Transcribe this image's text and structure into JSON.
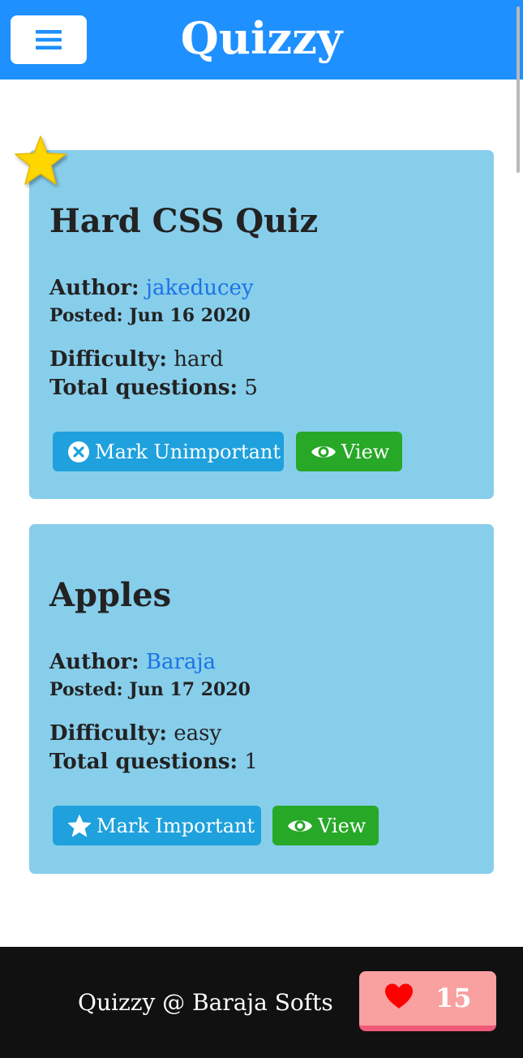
{
  "header": {
    "menu_icon": "hamburger-icon",
    "title": "Quizzy"
  },
  "colors": {
    "header_bg": "#1e90ff",
    "card_bg": "#87ceeb",
    "mark_button": "#1ea1dd",
    "view_button": "#27a827",
    "author_link": "#1a73e8",
    "footer_bg": "#111111",
    "like_bg": "#f9a0a0",
    "star": "#ffd700"
  },
  "quizzes": [
    {
      "important": true,
      "important_icon": "star-icon",
      "title": "Hard CSS Quiz",
      "author_label": "Author:",
      "author": "jakeducey",
      "posted_label": "Posted:",
      "posted": "Jun 16 2020",
      "difficulty_label": "Difficulty:",
      "difficulty": "hard",
      "total_label": "Total questions:",
      "total_questions": "5",
      "mark_button": "Mark Unimportant",
      "mark_icon": "close-circle-icon",
      "view_button": "View",
      "view_icon": "eye-icon"
    },
    {
      "important": false,
      "title": "Apples",
      "author_label": "Author:",
      "author": "Baraja",
      "posted_label": "Posted:",
      "posted": "Jun 17 2020",
      "difficulty_label": "Difficulty:",
      "difficulty": "easy",
      "total_label": "Total questions:",
      "total_questions": "1",
      "mark_button": "Mark Important",
      "mark_icon": "star-icon",
      "view_button": "View",
      "view_icon": "eye-icon"
    }
  ],
  "footer": {
    "text": "Quizzy @ Baraja Softs",
    "like_icon": "heart-icon",
    "like_count": "15"
  }
}
